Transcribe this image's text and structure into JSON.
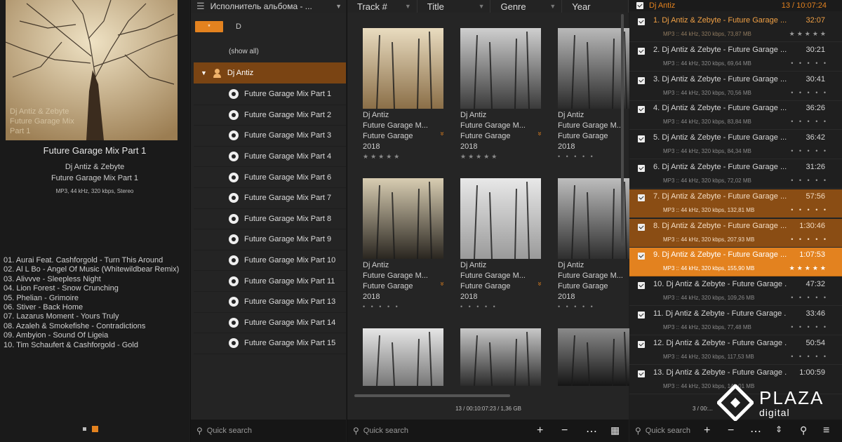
{
  "left": {
    "cover_caption": [
      "Dj Antiz & Zebyte",
      "Future Garage Mix",
      "Part 1"
    ],
    "now_playing": {
      "title": "Future Garage Mix Part 1",
      "artist": "Dj Antiz & Zebyte",
      "album": "Future Garage Mix Part 1",
      "info": "MP3, 44 kHz, 320 kbps, Stereo"
    },
    "tracklist": [
      "01. Aurai Feat. Cashforgold - Turn This Around",
      "02. Al L Bo - Angel Of Music (Whitewildbear Remix)",
      "03. Alivvve - Sleepless Night",
      "04. Lion Forest - Snow Crunching",
      "05. Phelian - Grimoire",
      "06. Stiver - Back Home",
      "07. Lazarus Moment - Yours Truly",
      "08. Azaleh & Smokefishe - Contradictions",
      "09. Ambyion - Sound Of Ligeia",
      "10. Tim Schaufert & Cashforgold - Gold"
    ]
  },
  "tree": {
    "header": "Исполнитель альбома - ...",
    "letter_button": "*",
    "letter": "D",
    "show_all": "(show all)",
    "artist": "Dj Antiz",
    "albums": [
      "Future Garage Mix Part 1",
      "Future Garage Mix Part 2",
      "Future Garage Mix Part 3",
      "Future Garage Mix Part 4",
      "Future Garage Mix Part 6",
      "Future Garage Mix Part 7",
      "Future Garage Mix Part 8",
      "Future Garage Mix Part 9",
      "Future Garage Mix Part 10",
      "Future Garage Mix Part 11",
      "Future Garage Mix Part 13",
      "Future Garage Mix Part 14",
      "Future Garage Mix Part 15"
    ],
    "search_placeholder": "Quick search"
  },
  "grid": {
    "columns": [
      "Track #",
      "Title",
      "Genre",
      "Year"
    ],
    "tiles": [
      {
        "artist": "Dj Antiz",
        "album": "Future Garage M...",
        "genre": "Future Garage",
        "year": "2018",
        "stars": "★★★★★",
        "expand": true
      },
      {
        "artist": "Dj Antiz",
        "album": "Future Garage M...",
        "genre": "Future Garage",
        "year": "2018",
        "stars": "★★★★★",
        "expand": true
      },
      {
        "artist": "Dj Antiz",
        "album": "Future Garage M...",
        "genre": "Future Garage",
        "year": "2018",
        "stars": "• • • • •",
        "expand": false
      },
      {
        "artist": "Dj Antiz",
        "album": "Future Garage M...",
        "genre": "Future Garage",
        "year": "2018",
        "stars": "• • • • •",
        "expand": true
      },
      {
        "artist": "Dj Antiz",
        "album": "Future Garage M...",
        "genre": "Future Garage",
        "year": "2018",
        "stars": "• • • • •",
        "expand": true
      },
      {
        "artist": "Dj Antiz",
        "album": "Future Garage M...",
        "genre": "Future Garage",
        "year": "2018",
        "stars": "• • • • •",
        "expand": false
      },
      {
        "artist": "",
        "album": "",
        "genre": "",
        "year": "",
        "stars": "",
        "expand": false
      },
      {
        "artist": "",
        "album": "",
        "genre": "",
        "year": "",
        "stars": "",
        "expand": false
      },
      {
        "artist": "",
        "album": "",
        "genre": "",
        "year": "",
        "stars": "",
        "expand": false
      }
    ],
    "status": "13 / 00:10:07:23 / 1,36 GB",
    "search_placeholder": "Quick search"
  },
  "playlist": {
    "title": "Dj Antiz",
    "count": "13 / 10:07:24",
    "tracks": [
      {
        "title": "1. Dj Antiz & Zebyte - Future Garage ...",
        "dur": "32:07",
        "info": "MP3 :: 44 kHz, 320 kbps, 73,87 MB",
        "stars": "★★★★★",
        "state": "current"
      },
      {
        "title": "2. Dj Antiz & Zebyte - Future Garage ...",
        "dur": "30:21",
        "info": "MP3 :: 44 kHz, 320 kbps, 69,64 MB",
        "stars": "• • • • •",
        "state": ""
      },
      {
        "title": "3. Dj Antiz & Zebyte - Future Garage ...",
        "dur": "30:41",
        "info": "MP3 :: 44 kHz, 320 kbps, 70,56 MB",
        "stars": "• • • • •",
        "state": ""
      },
      {
        "title": "4. Dj Antiz & Zebyte - Future Garage ...",
        "dur": "36:26",
        "info": "MP3 :: 44 kHz, 320 kbps, 83,84 MB",
        "stars": "• • • • •",
        "state": ""
      },
      {
        "title": "5. Dj Antiz & Zebyte - Future Garage ...",
        "dur": "36:42",
        "info": "MP3 :: 44 kHz, 320 kbps, 84,34 MB",
        "stars": "• • • • •",
        "state": ""
      },
      {
        "title": "6. Dj Antiz & Zebyte - Future Garage ...",
        "dur": "31:26",
        "info": "MP3 :: 44 kHz, 320 kbps, 72,02 MB",
        "stars": "• • • • •",
        "state": ""
      },
      {
        "title": "7. Dj Antiz & Zebyte - Future Garage ...",
        "dur": "57:56",
        "info": "MP3 :: 44 kHz, 320 kbps, 132,81 MB",
        "stars": "• • • • •",
        "state": "sel2"
      },
      {
        "title": "8. Dj Antiz & Zebyte - Future Garage ...",
        "dur": "1:30:46",
        "info": "MP3 :: 44 kHz, 320 kbps, 207,93 MB",
        "stars": "• • • • •",
        "state": "sel2"
      },
      {
        "title": "9. Dj Antiz & Zebyte - Future Garage ...",
        "dur": "1:07:53",
        "info": "MP3 :: 44 kHz, 320 kbps, 155,90 MB",
        "stars": "★★★★★",
        "state": "sel"
      },
      {
        "title": "10. Dj Antiz & Zebyte - Future Garage ...",
        "dur": "47:32",
        "info": "MP3 :: 44 kHz, 320 kbps, 109,26 MB",
        "stars": "• • • • •",
        "state": ""
      },
      {
        "title": "11. Dj Antiz & Zebyte - Future Garage ...",
        "dur": "33:46",
        "info": "MP3 :: 44 kHz, 320 kbps, 77,48 MB",
        "stars": "• • • • •",
        "state": ""
      },
      {
        "title": "12. Dj Antiz & Zebyte - Future Garage ...",
        "dur": "50:54",
        "info": "MP3 :: 44 kHz, 320 kbps, 117,53 MB",
        "stars": "• • • • •",
        "state": ""
      },
      {
        "title": "13. Dj Antiz & Zebyte - Future Garage ...",
        "dur": "1:00:59",
        "info": "MP3 :: 44 kHz, 320 kbps, 140,01 MB",
        "stars": "",
        "state": ""
      }
    ],
    "status": "3 / 00:...",
    "search_placeholder": "Quick search"
  },
  "logo": {
    "line1": "PLAZA",
    "line2": "digital"
  },
  "colors": {
    "accent": "#e3821f",
    "accent_dark": "#7a4413",
    "background": "#1e1e1e"
  }
}
